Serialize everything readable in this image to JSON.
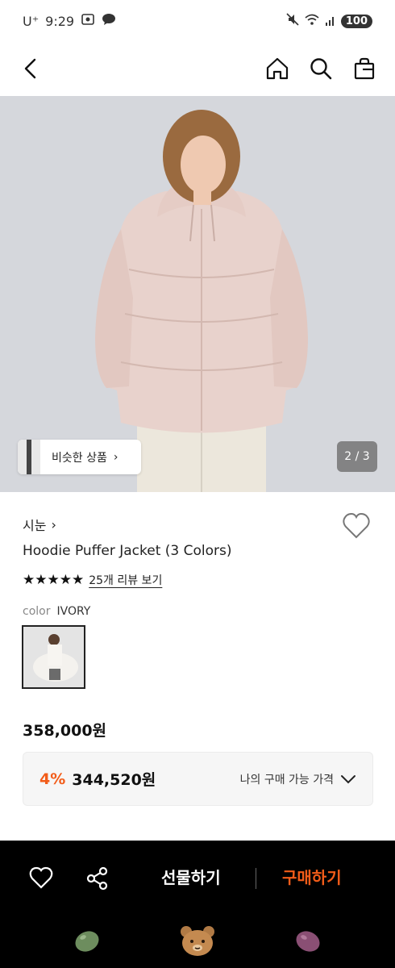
{
  "status_bar": {
    "carrier": "U⁺",
    "time": "9:29",
    "battery": "100"
  },
  "nav": {
    "icons": [
      "back-icon",
      "home-icon",
      "search-icon",
      "shopping-bag-icon"
    ]
  },
  "gallery": {
    "similar_label": "비슷한 상품",
    "similar_chevron": "›",
    "page_indicator": "2 / 3"
  },
  "product": {
    "brand": "시눈",
    "brand_chevron": "›",
    "name": "Hoodie Puffer Jacket (3 Colors)",
    "stars": "★★★★★",
    "rating": 5,
    "review_link": "25개 리뷰 보기",
    "color_label": "color",
    "color_value": "IVORY"
  },
  "pricing": {
    "price": "358,000원",
    "discount": "4%",
    "discounted_price": "344,520원",
    "my_price_label": "나의 구매 가능 가격"
  },
  "bottom_bar": {
    "gift_label": "선물하기",
    "buy_label": "구매하기"
  },
  "colors": {
    "accent": "#f25c19",
    "bottom_bar_bg": "#000000",
    "hero_bg": "#d9dbe0",
    "jacket": "#e8d2cc"
  }
}
